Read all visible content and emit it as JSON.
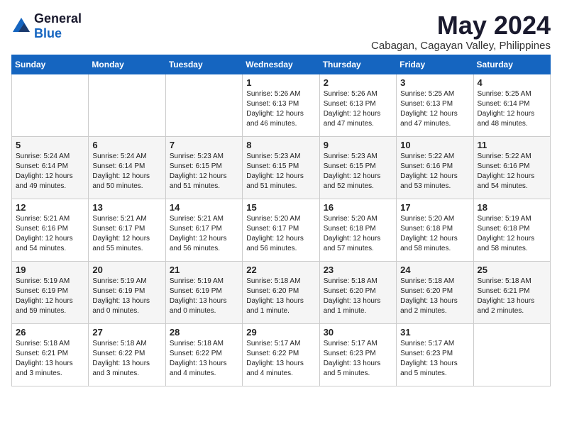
{
  "logo": {
    "general": "General",
    "blue": "Blue"
  },
  "header": {
    "month": "May 2024",
    "location": "Cabagan, Cagayan Valley, Philippines"
  },
  "weekdays": [
    "Sunday",
    "Monday",
    "Tuesday",
    "Wednesday",
    "Thursday",
    "Friday",
    "Saturday"
  ],
  "weeks": [
    [
      {
        "day": "",
        "info": ""
      },
      {
        "day": "",
        "info": ""
      },
      {
        "day": "",
        "info": ""
      },
      {
        "day": "1",
        "info": "Sunrise: 5:26 AM\nSunset: 6:13 PM\nDaylight: 12 hours\nand 46 minutes."
      },
      {
        "day": "2",
        "info": "Sunrise: 5:26 AM\nSunset: 6:13 PM\nDaylight: 12 hours\nand 47 minutes."
      },
      {
        "day": "3",
        "info": "Sunrise: 5:25 AM\nSunset: 6:13 PM\nDaylight: 12 hours\nand 47 minutes."
      },
      {
        "day": "4",
        "info": "Sunrise: 5:25 AM\nSunset: 6:14 PM\nDaylight: 12 hours\nand 48 minutes."
      }
    ],
    [
      {
        "day": "5",
        "info": "Sunrise: 5:24 AM\nSunset: 6:14 PM\nDaylight: 12 hours\nand 49 minutes."
      },
      {
        "day": "6",
        "info": "Sunrise: 5:24 AM\nSunset: 6:14 PM\nDaylight: 12 hours\nand 50 minutes."
      },
      {
        "day": "7",
        "info": "Sunrise: 5:23 AM\nSunset: 6:15 PM\nDaylight: 12 hours\nand 51 minutes."
      },
      {
        "day": "8",
        "info": "Sunrise: 5:23 AM\nSunset: 6:15 PM\nDaylight: 12 hours\nand 51 minutes."
      },
      {
        "day": "9",
        "info": "Sunrise: 5:23 AM\nSunset: 6:15 PM\nDaylight: 12 hours\nand 52 minutes."
      },
      {
        "day": "10",
        "info": "Sunrise: 5:22 AM\nSunset: 6:16 PM\nDaylight: 12 hours\nand 53 minutes."
      },
      {
        "day": "11",
        "info": "Sunrise: 5:22 AM\nSunset: 6:16 PM\nDaylight: 12 hours\nand 54 minutes."
      }
    ],
    [
      {
        "day": "12",
        "info": "Sunrise: 5:21 AM\nSunset: 6:16 PM\nDaylight: 12 hours\nand 54 minutes."
      },
      {
        "day": "13",
        "info": "Sunrise: 5:21 AM\nSunset: 6:17 PM\nDaylight: 12 hours\nand 55 minutes."
      },
      {
        "day": "14",
        "info": "Sunrise: 5:21 AM\nSunset: 6:17 PM\nDaylight: 12 hours\nand 56 minutes."
      },
      {
        "day": "15",
        "info": "Sunrise: 5:20 AM\nSunset: 6:17 PM\nDaylight: 12 hours\nand 56 minutes."
      },
      {
        "day": "16",
        "info": "Sunrise: 5:20 AM\nSunset: 6:18 PM\nDaylight: 12 hours\nand 57 minutes."
      },
      {
        "day": "17",
        "info": "Sunrise: 5:20 AM\nSunset: 6:18 PM\nDaylight: 12 hours\nand 58 minutes."
      },
      {
        "day": "18",
        "info": "Sunrise: 5:19 AM\nSunset: 6:18 PM\nDaylight: 12 hours\nand 58 minutes."
      }
    ],
    [
      {
        "day": "19",
        "info": "Sunrise: 5:19 AM\nSunset: 6:19 PM\nDaylight: 12 hours\nand 59 minutes."
      },
      {
        "day": "20",
        "info": "Sunrise: 5:19 AM\nSunset: 6:19 PM\nDaylight: 13 hours\nand 0 minutes."
      },
      {
        "day": "21",
        "info": "Sunrise: 5:19 AM\nSunset: 6:19 PM\nDaylight: 13 hours\nand 0 minutes."
      },
      {
        "day": "22",
        "info": "Sunrise: 5:18 AM\nSunset: 6:20 PM\nDaylight: 13 hours\nand 1 minute."
      },
      {
        "day": "23",
        "info": "Sunrise: 5:18 AM\nSunset: 6:20 PM\nDaylight: 13 hours\nand 1 minute."
      },
      {
        "day": "24",
        "info": "Sunrise: 5:18 AM\nSunset: 6:20 PM\nDaylight: 13 hours\nand 2 minutes."
      },
      {
        "day": "25",
        "info": "Sunrise: 5:18 AM\nSunset: 6:21 PM\nDaylight: 13 hours\nand 2 minutes."
      }
    ],
    [
      {
        "day": "26",
        "info": "Sunrise: 5:18 AM\nSunset: 6:21 PM\nDaylight: 13 hours\nand 3 minutes."
      },
      {
        "day": "27",
        "info": "Sunrise: 5:18 AM\nSunset: 6:22 PM\nDaylight: 13 hours\nand 3 minutes."
      },
      {
        "day": "28",
        "info": "Sunrise: 5:18 AM\nSunset: 6:22 PM\nDaylight: 13 hours\nand 4 minutes."
      },
      {
        "day": "29",
        "info": "Sunrise: 5:17 AM\nSunset: 6:22 PM\nDaylight: 13 hours\nand 4 minutes."
      },
      {
        "day": "30",
        "info": "Sunrise: 5:17 AM\nSunset: 6:23 PM\nDaylight: 13 hours\nand 5 minutes."
      },
      {
        "day": "31",
        "info": "Sunrise: 5:17 AM\nSunset: 6:23 PM\nDaylight: 13 hours\nand 5 minutes."
      },
      {
        "day": "",
        "info": ""
      }
    ]
  ]
}
